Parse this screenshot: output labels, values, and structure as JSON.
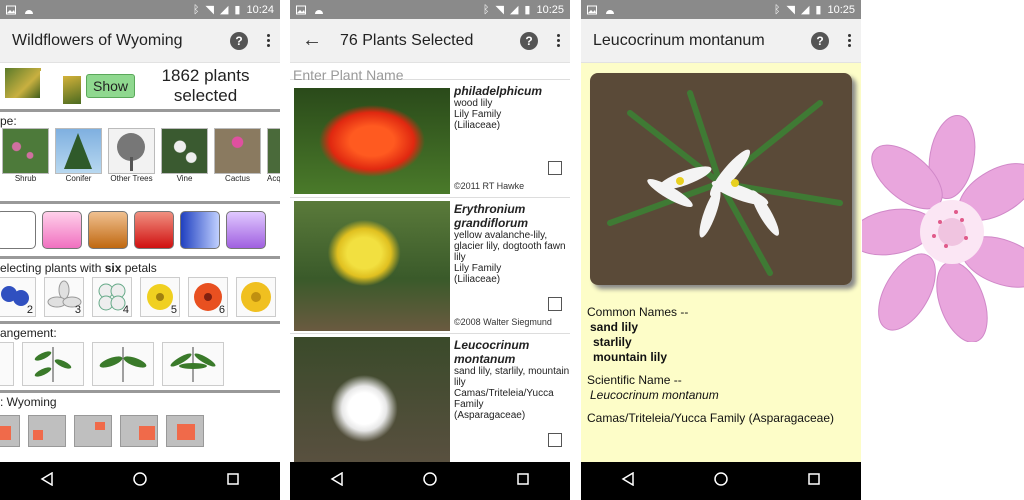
{
  "status": {
    "time1": "10:24",
    "time2": "10:25",
    "time3": "10:25"
  },
  "panel1": {
    "title": "Wildflowers of Wyoming",
    "show_label": "Show",
    "count_line1": "1862 plants",
    "count_line2": "selected",
    "type_label": "pe:",
    "types": [
      "Shrub",
      "Conifer",
      "Other Trees",
      "Vine",
      "Cactus",
      "Acqu"
    ],
    "petals_label_pre": "electing plants with ",
    "petals_label_bold": "six",
    "petals_label_post": " petals",
    "petal_nums": [
      "2",
      "3",
      "4",
      "5",
      "6",
      ""
    ],
    "arrangement_label": "angement:",
    "location_label": ": Wyoming"
  },
  "panel2": {
    "title": "76 Plants Selected",
    "search_placeholder": "Enter Plant Name",
    "items": [
      {
        "sci": "philadelphicum",
        "common": "wood lily",
        "family": "Lily Family",
        "family2": "(Liliaceae)",
        "credit": "©2011 RT Hawke"
      },
      {
        "sci": "Erythronium grandiflorum",
        "common": "yellow avalanche-lily, glacier lily, dogtooth fawn lily",
        "family": "Lily Family",
        "family2": "(Liliaceae)",
        "credit": "©2008 Walter Siegmund"
      },
      {
        "sci": "Leucocrinum montanum",
        "common": "sand lily, starlily, mountain lily",
        "family": "Camas/Triteleia/Yucca Family",
        "family2": "(Asparagaceae)",
        "credit": ""
      }
    ]
  },
  "panel3": {
    "title": "Leucocrinum montanum",
    "common_header": "Common Names --",
    "common_names": [
      "sand lily",
      "starlily",
      "mountain lily"
    ],
    "sci_header": "Scientific Name --",
    "sci_name": "Leucocrinum montanum",
    "family": "Camas/Triteleia/Yucca Family (Asparagaceae)"
  },
  "colors": {
    "accent": "#2a8a8a",
    "show_button": "#8fd88f",
    "detail_bg": "#fdfdc8",
    "statusbar": "#8a8a8a"
  }
}
